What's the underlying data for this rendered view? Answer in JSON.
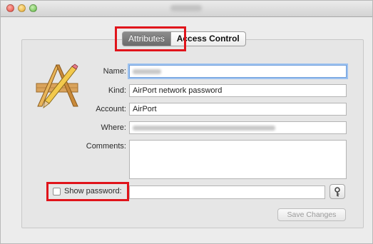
{
  "window": {
    "title_obscured": true
  },
  "tabs": [
    {
      "label": "Attributes",
      "active": true
    },
    {
      "label": "Access Control",
      "active": false
    }
  ],
  "form": {
    "name_label": "Name:",
    "kind_label": "Kind:",
    "kind_value": "AirPort network password",
    "account_label": "Account:",
    "account_value": "AirPort",
    "where_label": "Where:",
    "comments_label": "Comments:"
  },
  "show_password": {
    "label": "Show password:",
    "checked": false
  },
  "save_button": {
    "label": "Save Changes",
    "enabled": false
  },
  "colors": {
    "highlight": "#e0141b",
    "focus_ring": "#9cc1ef"
  },
  "icons": {
    "app": "keychain-access-icon",
    "key": "key-icon"
  }
}
